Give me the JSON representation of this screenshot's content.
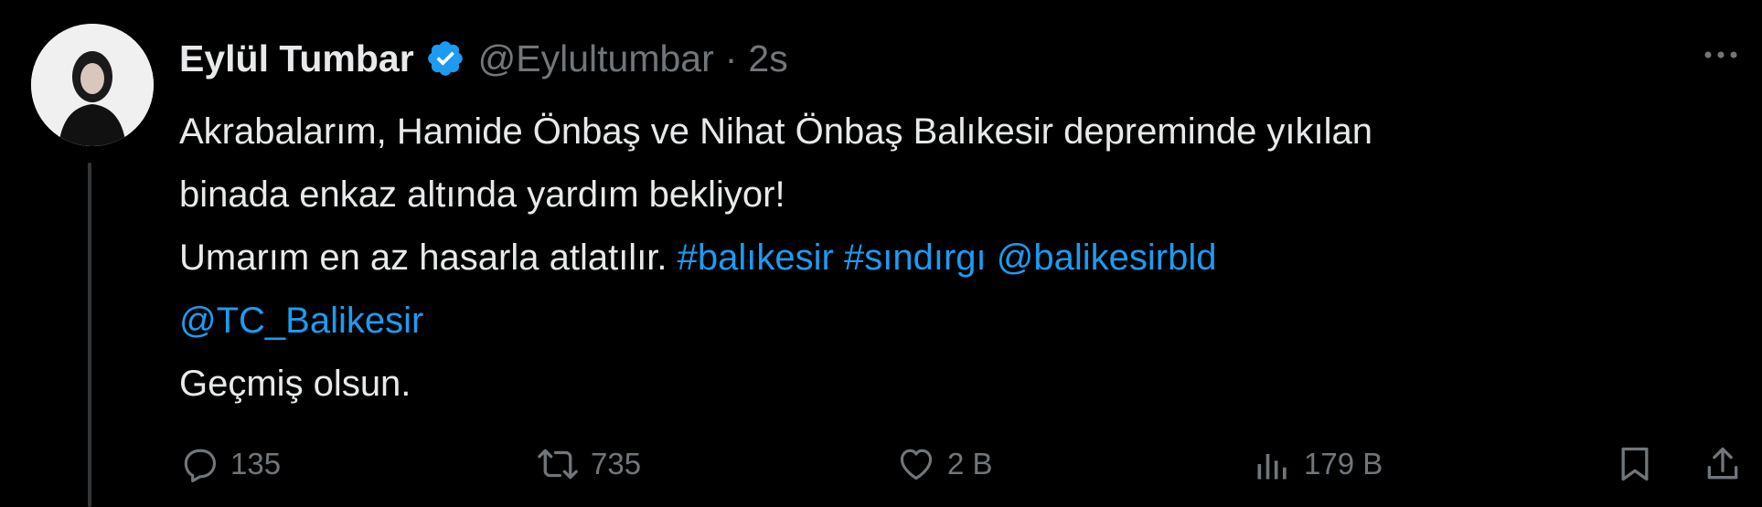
{
  "author": {
    "display_name": "Eylül Tumbar",
    "handle": "@Eylultumbar",
    "separator": "·",
    "time": "2s",
    "verified_icon": "verified-badge-icon",
    "verified_color": "#1d9bf0"
  },
  "tweet": {
    "line1": "Akrabalarım, Hamide Önbaş ve Nihat Önbaş Balıkesir depreminde yıkılan",
    "line2": "binada enkaz altında yardım bekliyor!",
    "line3_text": "Umarım en az hasarla atlatılır. ",
    "hashtag1": "#balıkesir",
    "hashtag2": "#sındırgı",
    "mention1": "@balikesirbld",
    "mention2": "@TC_Balikesir",
    "line5": "Geçmiş olsun."
  },
  "actions": {
    "reply": {
      "icon": "reply-icon",
      "count": "135"
    },
    "retweet": {
      "icon": "retweet-icon",
      "count": "735"
    },
    "like": {
      "icon": "heart-icon",
      "count": "2 B"
    },
    "views": {
      "icon": "views-icon",
      "count": "179 B"
    },
    "bookmark": {
      "icon": "bookmark-icon"
    },
    "share": {
      "icon": "share-icon"
    }
  },
  "colors": {
    "background": "#000000",
    "text": "#e7e9ea",
    "secondary": "#71767b",
    "link": "#1d9bf0"
  }
}
